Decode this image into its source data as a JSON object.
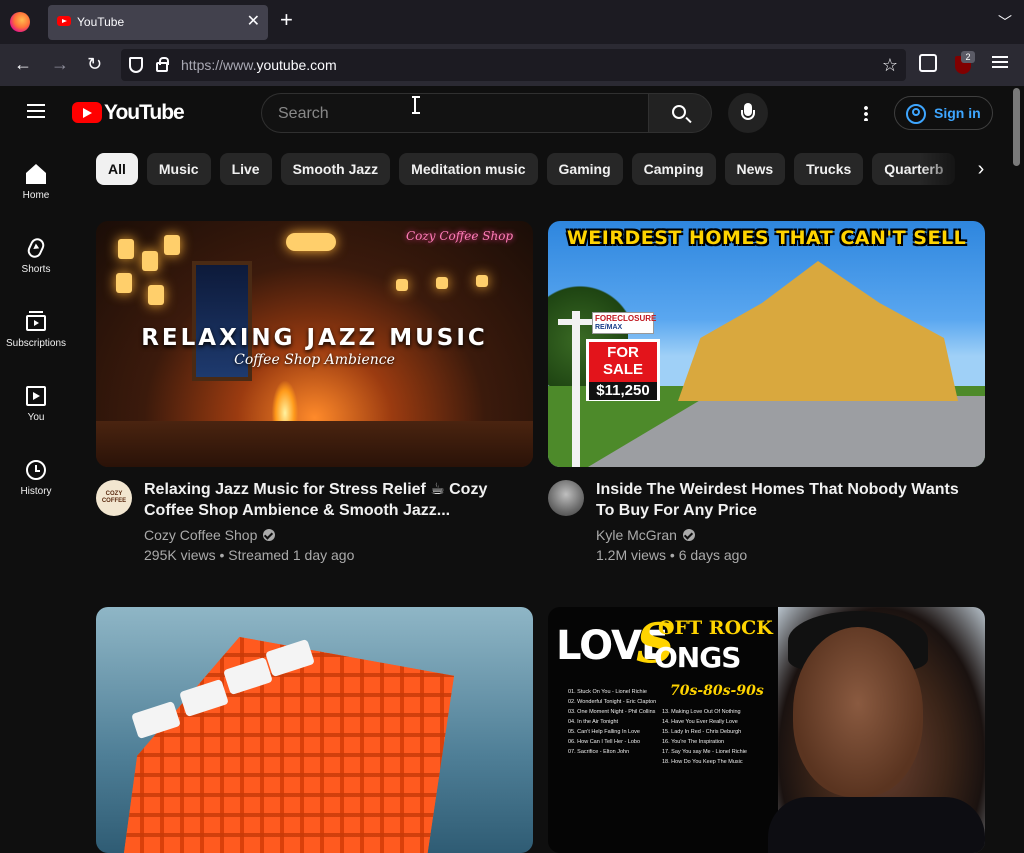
{
  "browser": {
    "tab_title": "YouTube",
    "url_prefix": "https://www.",
    "url_domain": "youtube.com",
    "extension_badge": "2",
    "icons": [
      "firefox-logo",
      "tab-close-icon",
      "new-tab-icon",
      "tab-list-icon",
      "back-icon",
      "forward-icon",
      "reload-icon",
      "shield-icon",
      "lock-icon",
      "bookmark-star-icon",
      "extensions-icon",
      "ublock-icon",
      "app-menu-icon"
    ]
  },
  "header": {
    "wordmark": "YouTube",
    "search_placeholder": "Search",
    "signin_label": "Sign in"
  },
  "sidebar": {
    "items": [
      {
        "label": "Home",
        "icon": "home-icon"
      },
      {
        "label": "Shorts",
        "icon": "shorts-icon"
      },
      {
        "label": "Subscriptions",
        "icon": "subscriptions-icon"
      },
      {
        "label": "You",
        "icon": "you-icon"
      },
      {
        "label": "History",
        "icon": "history-icon"
      }
    ]
  },
  "chips": [
    "All",
    "Music",
    "Live",
    "Smooth Jazz",
    "Meditation music",
    "Gaming",
    "Camping",
    "News",
    "Trucks",
    "Quarterb"
  ],
  "videos": [
    {
      "title": "Relaxing Jazz Music for Stress Relief ☕ Cozy Coffee Shop Ambience & Smooth Jazz...",
      "channel": "Cozy Coffee Shop",
      "meta": "295K views • Streamed 1 day ago",
      "thumb_text_1": "RELAXING JAZZ MUSIC",
      "thumb_text_2": "Coffee Shop Ambience",
      "thumb_neon": "Cozy Coffee Shop",
      "avatar_text": "COZY COFFEE"
    },
    {
      "title": "Inside The Weirdest Homes That Nobody Wants To Buy For Any Price",
      "channel": "Kyle McGran",
      "meta": "1.2M views • 6 days ago",
      "thumb_title": "WEIRDEST HOMES THAT CAN'T SELL",
      "sign_top_1": "FORECLOSURE",
      "sign_top_2": "RE/MAX",
      "sign_line_1": "FOR",
      "sign_line_2": "SALE",
      "sign_price": "$11,250"
    },
    {
      "title": "",
      "channel": "",
      "meta": ""
    },
    {
      "title": "",
      "channel": "",
      "meta": "",
      "thumb_soft": "OFT ROCK",
      "thumb_love": "LOVE",
      "thumb_s": "S",
      "thumb_songs": "ONGS",
      "thumb_era": "70s-80s-90s",
      "tracks_left": [
        "01. Stuck On You - Lionel Richie",
        "02. Wonderful Tonight - Eric Clapton",
        "03. One Moment Night - Phil Collins",
        "04. In the Air Tonight",
        "05. Can't Help Falling In Love",
        "06. How Can I Tell Her - Lobo",
        "07. Sacrifice - Elton John"
      ],
      "tracks_right": [
        "13. Making Love Out Of Nothing",
        "14. Have You Ever Really Love",
        "15. Lady In Red - Chris Deburgh",
        "16. You're The Inspiration",
        "17. Say You say Me - Lionel Richie",
        "18. How Do You Keep The Music"
      ]
    }
  ],
  "colors": {
    "background": "#0f0f0f",
    "accent_red": "#ff0000",
    "link_blue": "#3ea6ff",
    "chip_bg": "#272727"
  }
}
